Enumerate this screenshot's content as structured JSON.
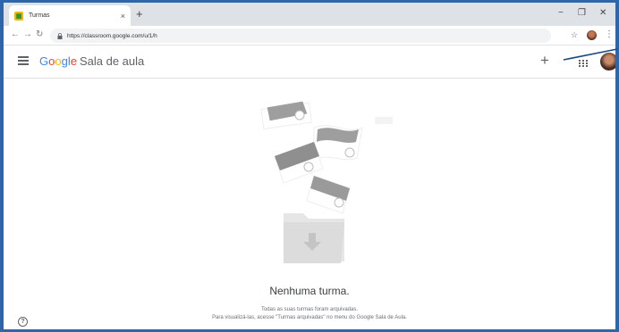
{
  "browser": {
    "tab_title": "Turmas",
    "tab_close": "×",
    "new_tab": "+",
    "url": "https://classroom.google.com/u/1/h",
    "window_controls": {
      "minimize": "−",
      "restore": "❐",
      "close": "✕"
    }
  },
  "app": {
    "brand_letters": [
      "G",
      "o",
      "o",
      "g",
      "l",
      "e"
    ],
    "product_name": "Sala de aula",
    "add_button": "+"
  },
  "empty_state": {
    "title": "Nenhuma turma.",
    "line1": "Todas as suas turmas foram arquivadas.",
    "line2": "Para visualizá-las, acesse \"Turmas arquivadas\" no menu do Google Sala de Aula."
  },
  "help": {
    "label": "?"
  },
  "colors": {
    "frame": "#2f66a9",
    "accent_line": "#1e4a82"
  }
}
